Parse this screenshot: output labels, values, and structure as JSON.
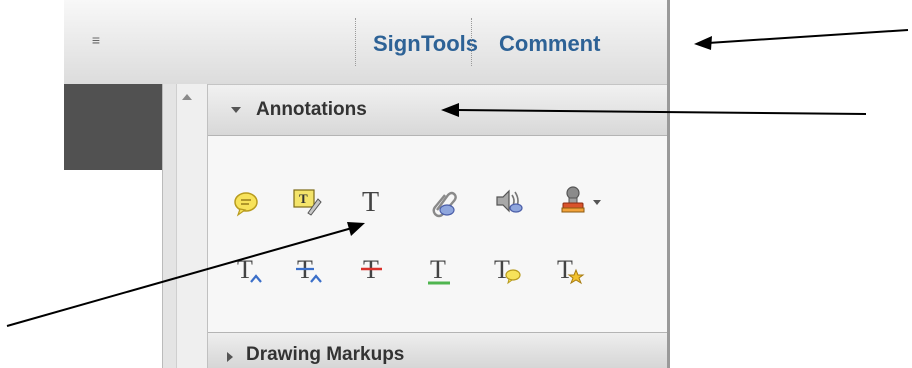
{
  "toolbar": {
    "menu_glyph": "≡",
    "tabs": [
      {
        "label": "Tools"
      },
      {
        "label": "Sign"
      },
      {
        "label": "Comment"
      }
    ]
  },
  "panel": {
    "annotations": {
      "title": "Annotations",
      "tools": [
        {
          "icon": "sticky-note-icon"
        },
        {
          "icon": "highlight-text-icon"
        },
        {
          "icon": "add-text-icon",
          "glyph": "T"
        },
        {
          "icon": "attach-file-icon"
        },
        {
          "icon": "record-audio-icon"
        },
        {
          "icon": "stamp-icon"
        },
        {
          "icon": "insert-text-icon",
          "glyph": "T"
        },
        {
          "icon": "replace-text-icon",
          "glyph": "T"
        },
        {
          "icon": "strikethrough-icon",
          "glyph": "T"
        },
        {
          "icon": "underline-icon",
          "glyph": "T"
        },
        {
          "icon": "text-note-icon",
          "glyph": "T"
        },
        {
          "icon": "text-star-icon",
          "glyph": "T"
        }
      ]
    },
    "drawing_markups": {
      "title": "Drawing Markups"
    }
  },
  "colors": {
    "tab_text": "#2d6296",
    "note_yellow": "#f7e25a",
    "underline_green": "#4fb54f",
    "strike_red": "#d9312b",
    "replace_blue": "#3b6fc9"
  }
}
